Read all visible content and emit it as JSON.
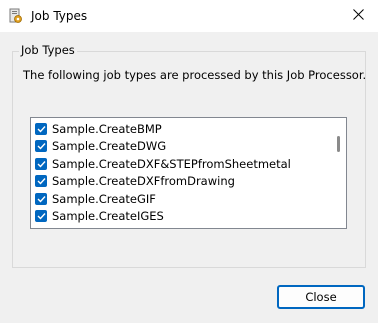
{
  "window": {
    "title": "Job Types"
  },
  "group": {
    "legend": "Job Types",
    "description": "The following job types are processed by this Job Processor."
  },
  "job_types": [
    {
      "label": "Sample.CreateBMP",
      "checked": true
    },
    {
      "label": "Sample.CreateDWG",
      "checked": true
    },
    {
      "label": "Sample.CreateDXF&STEPfromSheetmetal",
      "checked": true
    },
    {
      "label": "Sample.CreateDXFfromDrawing",
      "checked": true
    },
    {
      "label": "Sample.CreateGIF",
      "checked": true
    },
    {
      "label": "Sample.CreateIGES",
      "checked": true
    }
  ],
  "buttons": {
    "close": "Close"
  },
  "colors": {
    "accent": "#0067c0",
    "background": "#f0f0f0",
    "titlebar": "#ffffff"
  },
  "icons": {
    "app": "app-icon",
    "window_close": "close-icon",
    "checkbox": "checkmark-icon"
  }
}
